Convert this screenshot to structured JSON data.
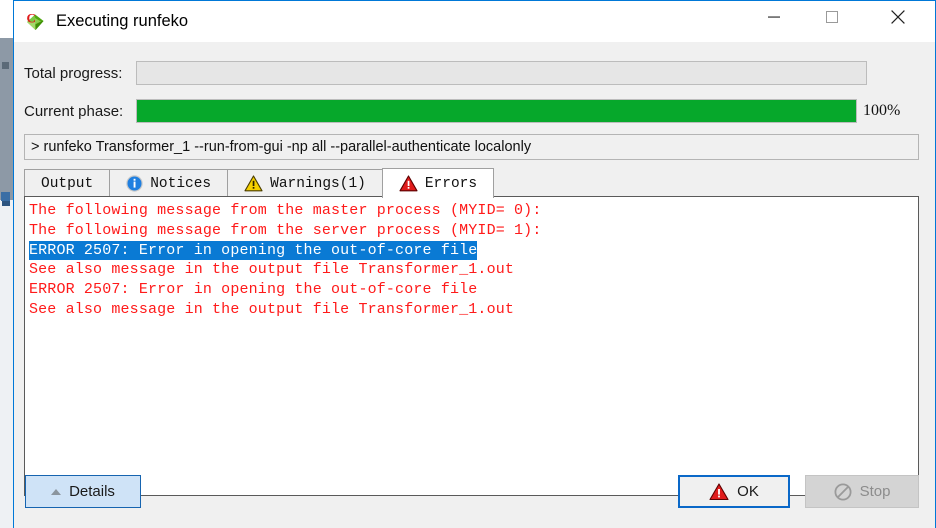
{
  "window": {
    "title": "Executing runfeko",
    "app_icon": "feko-leaf-icon",
    "controls": {
      "minimize": "minimize-icon",
      "maximize": "maximize-icon",
      "close": "close-icon"
    }
  },
  "progress": {
    "total": {
      "label": "Total progress:",
      "percent": 0,
      "percent_text": ""
    },
    "phase": {
      "label": "Current phase:",
      "percent": 100,
      "percent_text": "100%"
    }
  },
  "command_line": "> runfeko Transformer_1 --run-from-gui -np all --parallel-authenticate localonly",
  "tabs": [
    {
      "label": "Output",
      "icon": null,
      "active": false
    },
    {
      "label": "Notices",
      "icon": "info-icon",
      "active": false
    },
    {
      "label": "Warnings(1)",
      "icon": "warning-icon",
      "active": false
    },
    {
      "label": "Errors",
      "icon": "error-icon",
      "active": true
    }
  ],
  "log": {
    "lines": [
      {
        "text": "The following message from the master process (MYID= 0):",
        "selected": false
      },
      {
        "text": "The following message from the server process (MYID= 1):",
        "selected": false
      },
      {
        "text": "ERROR 2507: Error in opening the out-of-core file",
        "selected": true
      },
      {
        "text": "See also message in the output file Transformer_1.out",
        "selected": false
      },
      {
        "text": "ERROR 2507: Error in opening the out-of-core file",
        "selected": false
      },
      {
        "text": "See also message in the output file Transformer_1.out",
        "selected": false
      }
    ]
  },
  "footer": {
    "details": {
      "label": "Details",
      "icon": "triangle-up-icon",
      "enabled": true
    },
    "ok": {
      "label": "OK",
      "icon": "error-icon",
      "enabled": true
    },
    "stop": {
      "label": "Stop",
      "icon": "no-entry-icon",
      "enabled": false
    }
  },
  "colors": {
    "progress_fill": "#06a82b",
    "selection": "#0a7ad4",
    "error_text": "#ff1a1a",
    "accent_border": "#0078d7",
    "warning_yellow": "#f5d000",
    "error_red": "#e01b1b",
    "info_blue": "#1f7fe0"
  }
}
